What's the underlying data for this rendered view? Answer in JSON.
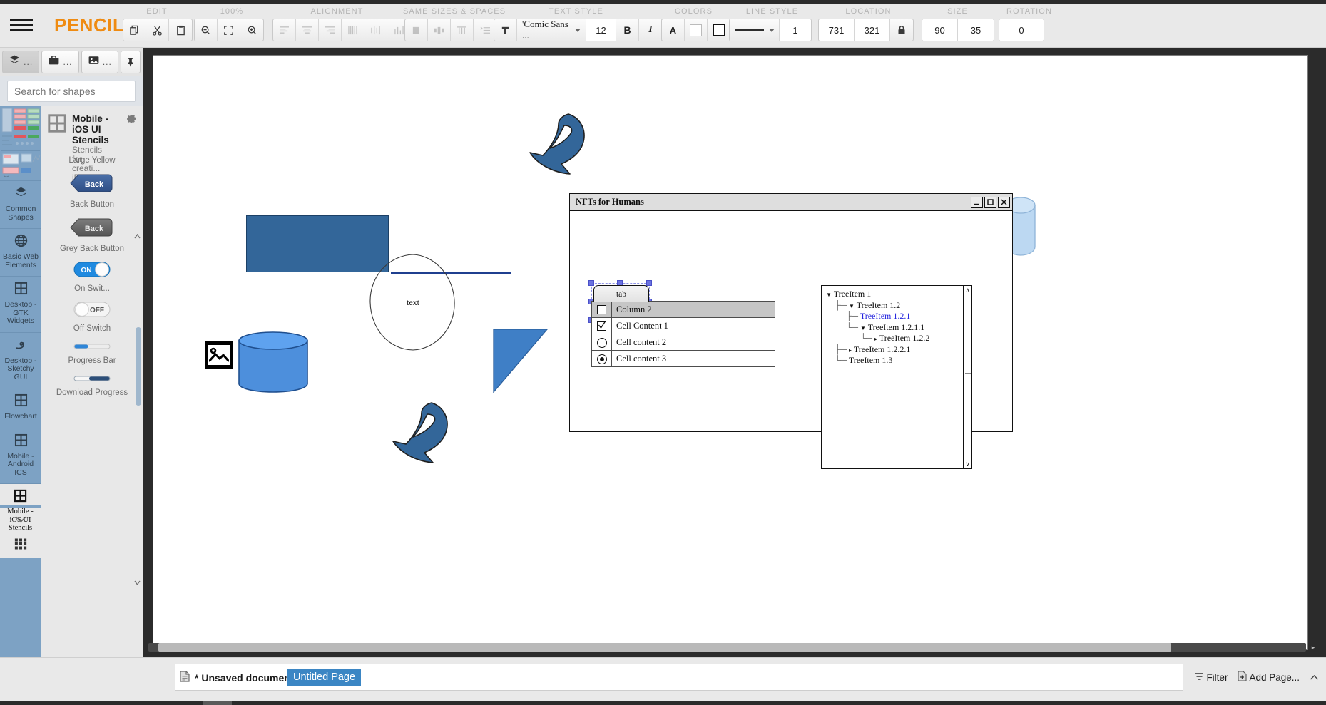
{
  "app": {
    "name": "PENCIL",
    "menu_icon": "hamburger-icon"
  },
  "toolbar": {
    "groups": [
      {
        "label": "EDIT",
        "buttons": [
          "copy-icon",
          "cut-icon",
          "paste-icon"
        ]
      },
      {
        "label": "100%",
        "buttons": [
          "zoom-out-icon",
          "zoom-fit-icon",
          "zoom-in-icon"
        ]
      },
      {
        "label": "ALIGNMENT",
        "buttons": [
          "align-left-icon",
          "align-center-icon",
          "align-right-icon",
          "align-top-icon",
          "align-middle-icon",
          "align-bottom-icon"
        ]
      },
      {
        "label": "SAME SIZES & SPACES",
        "buttons": [
          "same-width-icon",
          "same-height-icon",
          "distribute-h-icon",
          "distribute-v-icon"
        ]
      },
      {
        "label": "TEXT STYLE"
      },
      {
        "label": "COLORS"
      },
      {
        "label": "LINE STYLE"
      },
      {
        "label": "LOCATION"
      },
      {
        "label": "SIZE"
      },
      {
        "label": "ROTATION"
      }
    ],
    "text_style": {
      "paint_icon": "text-format-icon",
      "font_family": "'Comic Sans ...",
      "font_size": "12",
      "bold_label": "B",
      "italic_label": "I"
    },
    "colors": {
      "text_color_label": "A",
      "fill_swatch": "#ffffff",
      "stroke_swatch": "#ffffff"
    },
    "line_style": {
      "pattern_icon": "solid-line-icon",
      "width": "1"
    },
    "location": {
      "x": "731",
      "y": "321",
      "lock_icon": "lock-icon"
    },
    "size": {
      "w": "90",
      "h": "35"
    },
    "rotation": {
      "value": "0"
    }
  },
  "sidebar": {
    "tabs": [
      {
        "name": "layers-tab",
        "icon": "layers-icon",
        "dots": "..."
      },
      {
        "name": "tools-tab",
        "icon": "briefcase-icon",
        "dots": "..."
      },
      {
        "name": "images-tab",
        "icon": "image-icon",
        "dots": "..."
      }
    ],
    "pin_icon": "pin-icon",
    "search": {
      "placeholder": "Search for shapes",
      "value": ""
    },
    "categories": [
      {
        "label": "Common Shapes",
        "icon": "layers-icon",
        "selected": false
      },
      {
        "label": "Basic Web Elements",
        "icon": "globe-icon",
        "selected": false
      },
      {
        "label": "Desktop - GTK Widgets",
        "icon": "grid-icon",
        "selected": false
      },
      {
        "label": "Desktop - Sketchy GUI",
        "icon": "squiggle-icon",
        "selected": false
      },
      {
        "label": "Flowchart",
        "icon": "grid-icon",
        "selected": false
      },
      {
        "label": "Mobile - Android ICS",
        "icon": "grid-icon",
        "selected": false
      },
      {
        "label": "Mobile - iOS UI Stencils",
        "icon": "grid-icon",
        "selected": true
      }
    ],
    "more_icon": "chevron-down-icon",
    "all_collections_icon": "grid-dots-icon",
    "collection": {
      "title": "Mobile - iOS UI Stencils",
      "description": "Stencils for creati... iPhon...",
      "settings_icon": "gear-icon"
    },
    "shapes": [
      {
        "label": "Large Yellow",
        "kind": "partial-top"
      },
      {
        "label": "Back Button",
        "kind": "back-button-blue",
        "text": "Back"
      },
      {
        "label": "Grey Back Button",
        "kind": "back-button-grey",
        "text": "Back"
      },
      {
        "label": "On Swit...",
        "kind": "switch-on",
        "text": "ON"
      },
      {
        "label": "Off Switch",
        "kind": "switch-off",
        "text": "OFF"
      },
      {
        "label": "Progress Bar",
        "kind": "progress-bar"
      },
      {
        "label": "Download Progress",
        "kind": "download-progress"
      }
    ]
  },
  "canvas": {
    "shapes": [
      {
        "name": "blue-rectangle",
        "type": "rect",
        "fill": "#336699"
      },
      {
        "name": "blue-line",
        "type": "line",
        "stroke": "#1f3f8f"
      },
      {
        "name": "blue-cylinder",
        "type": "cylinder",
        "fill": "#4d8fdc"
      },
      {
        "name": "image-placeholder-icon",
        "type": "icon"
      },
      {
        "name": "blue-triangle",
        "type": "triangle",
        "fill": "#3f7fc6"
      },
      {
        "name": "sketchy-ellipse",
        "type": "ellipse",
        "label": "text"
      },
      {
        "name": "blue-arrow-top",
        "type": "arrow",
        "fill": "#336699"
      },
      {
        "name": "blue-arrow-bottom",
        "type": "arrow",
        "fill": "#336699"
      }
    ],
    "window": {
      "title": "NFTs for Humans",
      "minimize_icon": "minimize-icon",
      "maximize_icon": "maximize-icon",
      "close_icon": "close-icon",
      "tab_label": "tab",
      "table": {
        "header": [
          "",
          "Column 2"
        ],
        "rows": [
          {
            "control": "checkbox-checked",
            "text": "Cell Content 1"
          },
          {
            "control": "radio-unchecked",
            "text": "Cell content 2"
          },
          {
            "control": "radio-checked",
            "text": "Cell content 3"
          }
        ]
      },
      "tree": {
        "scroll_up_icon": "scroll-up-icon",
        "scroll_down_icon": "scroll-down-icon",
        "nodes": [
          {
            "label": "TreeItem 1",
            "depth": 0,
            "marker": "expanded",
            "highlight": false
          },
          {
            "label": "TreeItem 1.2",
            "depth": 1,
            "marker": "expanded",
            "highlight": false
          },
          {
            "label": "TreeItem 1.2.1",
            "depth": 2,
            "marker": "none",
            "highlight": true
          },
          {
            "label": "TreeItem 1.2.1.1",
            "depth": 2,
            "marker": "expanded",
            "highlight": false
          },
          {
            "label": "TreeItem 1.2.2",
            "depth": 3,
            "marker": "collapsed",
            "highlight": false
          },
          {
            "label": "TreeItem 1.2.2.1",
            "depth": 1,
            "marker": "collapsed",
            "highlight": false
          },
          {
            "label": "TreeItem 1.3",
            "depth": 1,
            "marker": "none",
            "highlight": false
          }
        ]
      }
    }
  },
  "statusbar": {
    "doc_icon": "document-icon",
    "document_name": "* Unsaved document",
    "page_tab": "Untitled Page",
    "filter_label": "Filter",
    "filter_icon": "filter-icon",
    "add_page_label": "Add Page...",
    "add_page_icon": "add-page-icon",
    "expand_icon": "chevron-up-icon"
  }
}
